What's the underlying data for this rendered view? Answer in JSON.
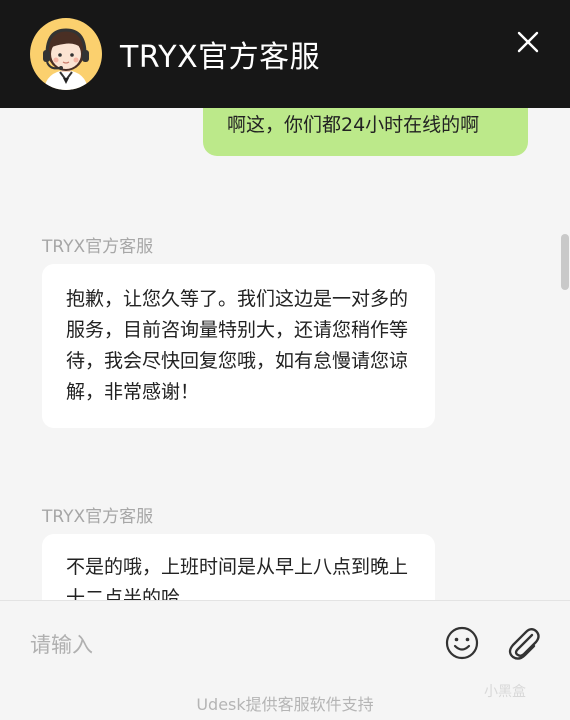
{
  "header": {
    "title": "TRYX官方客服",
    "avatar_icon": "customer-service-avatar-icon",
    "close_icon": "close-icon"
  },
  "messages": [
    {
      "direction": "outgoing",
      "text": "啊这，你们都24小时在线的啊"
    },
    {
      "direction": "incoming",
      "sender": "TRYX官方客服",
      "text": "抱歉，让您久等了。我们这边是一对多的服务，目前咨询量特别大，还请您稍作等待，我会尽快回复您哦，如有怠慢请您谅解，非常感谢！"
    },
    {
      "direction": "incoming",
      "sender": "TRYX官方客服",
      "text": "不是的哦，上班时间是从早上八点到晚上十二点半的哈"
    }
  ],
  "input": {
    "placeholder": "请输入",
    "value": ""
  },
  "footer": {
    "text": "Udesk提供客服软件支持",
    "watermark": "小黑盒"
  },
  "colors": {
    "header_bg": "#171717",
    "outgoing_bubble": "#bce98a",
    "incoming_bubble": "#ffffff",
    "chat_bg": "#f5f5f5",
    "avatar_bg": "#fbd06e"
  }
}
